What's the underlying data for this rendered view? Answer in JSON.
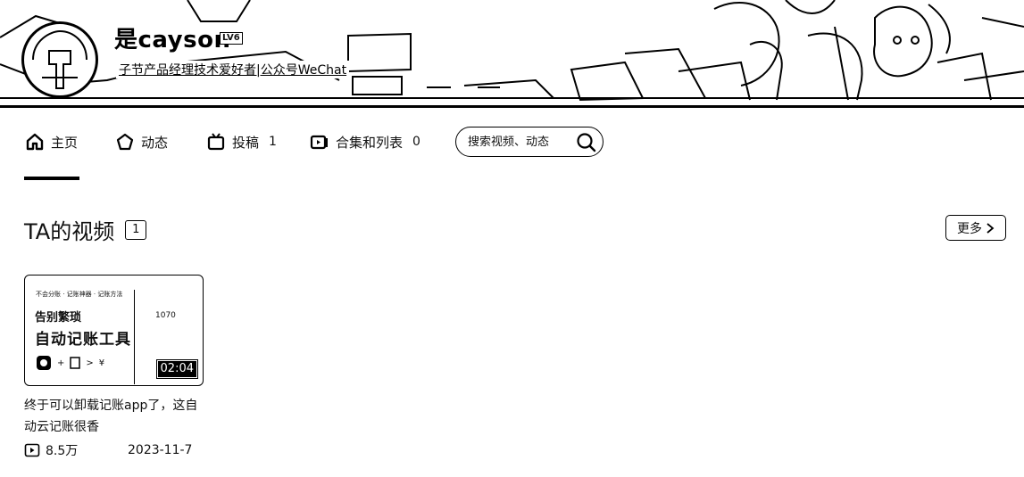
{
  "header": {
    "username": "是cayson",
    "level_badge": "LV6",
    "bio": "子节产品经理技术爱好者|公众号WeChat"
  },
  "nav": {
    "items": [
      {
        "label": "主页",
        "icon": "home-icon"
      },
      {
        "label": "动态",
        "icon": "dynamic-icon"
      },
      {
        "label": "投稿",
        "icon": "tv-icon",
        "count": "1"
      },
      {
        "label": "合集和列表",
        "icon": "collection-icon",
        "count": "0"
      }
    ],
    "search_placeholder": "搜索视频、动态"
  },
  "section": {
    "title": "TA的视频",
    "count": "1",
    "more_label": "更多"
  },
  "videos": [
    {
      "thumb_top_text": "不会分账 · 记账神器 · 记账方法",
      "thumb_line1": "告别繁琐",
      "thumb_line2": "自动记账工具",
      "thumb_amount": "1070",
      "thumb_symbol": "¥",
      "duration": "02:04",
      "title": "终于可以卸载记账app了，这自动云记账很香",
      "plays": "8.5万",
      "date": "2023-11-7"
    }
  ],
  "colors": {
    "primary": "#000000",
    "background": "#ffffff"
  }
}
